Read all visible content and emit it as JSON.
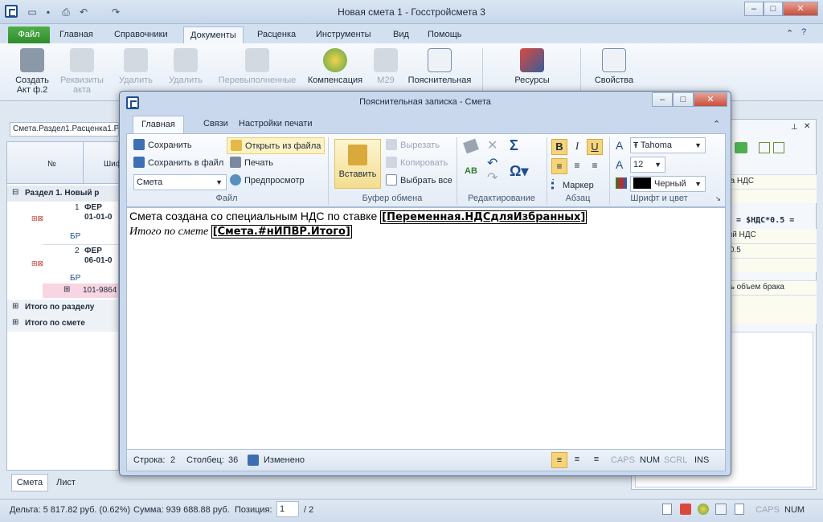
{
  "window": {
    "title": "Новая смета 1 - Госстройсмета 3"
  },
  "menu": {
    "file": "Файл",
    "tabs": [
      "Главная",
      "Справочники",
      "Документы",
      "Расценка",
      "Инструменты",
      "Вид",
      "Помощь"
    ]
  },
  "ribbon": {
    "buttons": [
      "Создать Акт ф.2",
      "Реквизиты акта",
      "Удалить",
      "Удалить",
      "Перевыполненные",
      "Компенсация",
      "М29",
      "Пояснительная",
      "Ресурсы",
      "Свойства"
    ]
  },
  "left": {
    "breadcrumb": "Смета.Раздел1.Расценка1.Р",
    "col_no": "№",
    "col_code": "Шиф",
    "section": "Раздел 1. Новый р",
    "row1_no": "1",
    "row1_code": "ФЕР",
    "row1_sub": "01-01-0",
    "row1_badge": "БР",
    "row2_no": "2",
    "row2_code": "ФЕР",
    "row2_sub": "06-01-0",
    "row2_badge": "БР",
    "resource": "101-9864",
    "total_section": "Итого по разделу",
    "total_estimate": "Итого по смете",
    "tab_estimate": "Смета",
    "tab_sheet": "Лист"
  },
  "right": {
    "lines": [
      "ка НДС",
      "х = $НДС*0.5 =",
      "ый НДС",
      "*0.5",
      "ть объем брака"
    ]
  },
  "status": {
    "delta": "Дельта: 5 817.82 руб. (0.62%)",
    "sum": "Сумма: 939 688.88 руб.",
    "position_label": "Позиция:",
    "position_value": "1",
    "position_total": "/ 2",
    "caps": "CAPS",
    "num": "NUM"
  },
  "dialog": {
    "title": "Пояснительная записка - Смета",
    "tabs": [
      "Главная",
      "Связи",
      "Настройки печати"
    ],
    "file": {
      "save": "Сохранить",
      "save_to_file": "Сохранить в файл",
      "template": "Смета",
      "open": "Открыть из файла",
      "print": "Печать",
      "preview": "Предпросмотр",
      "group": "Файл"
    },
    "clipboard": {
      "paste": "Вставить",
      "cut": "Вырезать",
      "copy": "Копировать",
      "select_all": "Выбрать все",
      "group": "Буфер обмена"
    },
    "editing": {
      "group": "Редактирование"
    },
    "paragraph": {
      "bold": "B",
      "italic": "I",
      "underline": "U",
      "marker": "Маркер",
      "group": "Абзац"
    },
    "font": {
      "name": "Tahoma",
      "size": "12",
      "color": "Черный",
      "group": "Шрифт и цвет"
    },
    "text": {
      "line1": "Смета создана со специальным НДС по ставке ",
      "field1": "[Переменная.НДСдляИзбранных]",
      "line2": "Итого по смете ",
      "field2": "[Смета.#нИПВР.Итого]"
    },
    "status": {
      "row_label": "Строка:",
      "row": "2",
      "col_label": "Столбец:",
      "col": "36",
      "state": "Изменено",
      "caps": "CAPS",
      "num": "NUM",
      "scrl": "SCRL",
      "ins": "INS"
    }
  }
}
